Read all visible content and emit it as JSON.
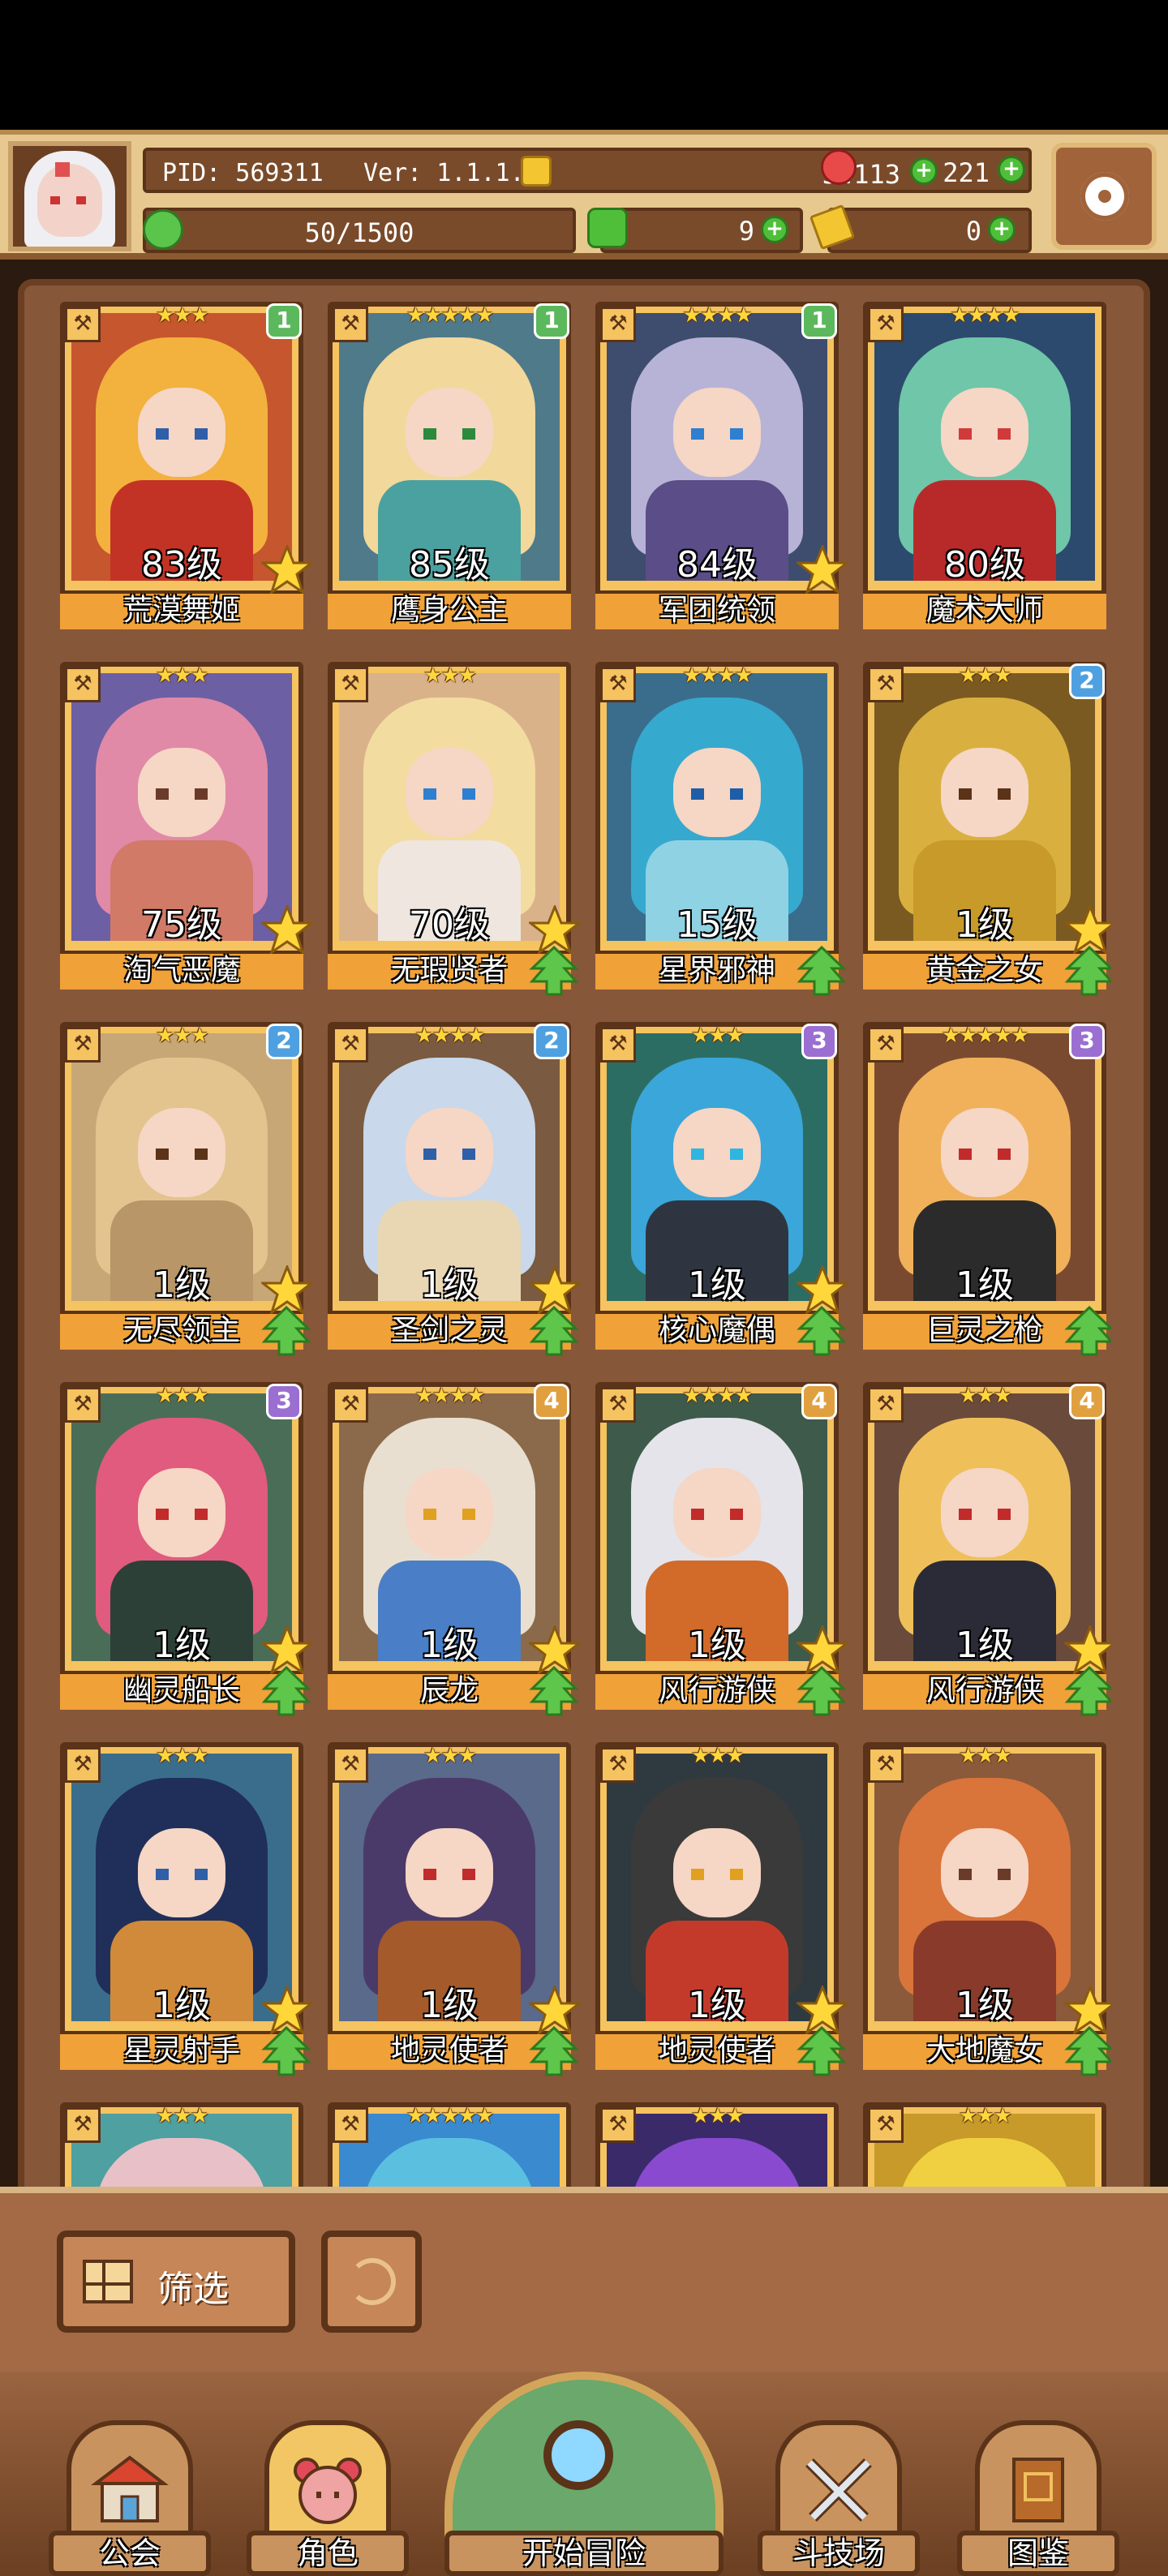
{
  "header": {
    "pid": "PID: 569311",
    "version": "Ver: 1.1.1.6",
    "gold": "54113",
    "gems": "221",
    "energy": "50/1500",
    "clover_count": "9",
    "keys": "0"
  },
  "cards": [
    {
      "stars": "★★★",
      "rank": "1",
      "rank_color": "#5cb85c",
      "level": "83级",
      "name": "荒漠舞姬",
      "bg": "#c6562d",
      "hair": "#f3b13d",
      "body": "#c33325",
      "eye": "#2f5fa8",
      "fav": true,
      "up": false
    },
    {
      "stars": "★★★★★",
      "rank": "1",
      "rank_color": "#5cb85c",
      "level": "85级",
      "name": "鹰身公主",
      "bg": "#4f7a8a",
      "hair": "#f2d89a",
      "body": "#4aa1a0",
      "eye": "#2b8a3b",
      "fav": false,
      "up": false
    },
    {
      "stars": "★★★★",
      "rank": "1",
      "rank_color": "#5cb85c",
      "level": "84级",
      "name": "军团统领",
      "bg": "#3e4d6e",
      "hair": "#b7b3d6",
      "body": "#5b4d87",
      "eye": "#2f7fd0",
      "fav": true,
      "up": false
    },
    {
      "stars": "★★★★",
      "rank": "",
      "rank_color": "",
      "level": "80级",
      "name": "魔术大师",
      "bg": "#2c4a6d",
      "hair": "#6fc6a9",
      "body": "#b82a2a",
      "eye": "#d13a3a",
      "fav": false,
      "up": false
    },
    {
      "stars": "★★★",
      "rank": "",
      "rank_color": "",
      "level": "75级",
      "name": "淘气恶魔",
      "bg": "#6d5fa3",
      "hair": "#e08aa7",
      "body": "#d27a68",
      "eye": "#6b3b2a",
      "fav": true,
      "up": false
    },
    {
      "stars": "★★★",
      "rank": "",
      "rank_color": "",
      "level": "70级",
      "name": "无瑕贤者",
      "bg": "#d9b28a",
      "hair": "#f3dca0",
      "body": "#f0e6e0",
      "eye": "#2f7fd0",
      "fav": true,
      "up": true
    },
    {
      "stars": "★★★★",
      "rank": "",
      "rank_color": "#4fb7d8",
      "level": "15级",
      "name": "星界邪神",
      "bg": "#3a6d8c",
      "hair": "#36a9cf",
      "body": "#8fd2e3",
      "eye": "#1e5ea8",
      "fav": false,
      "up": true
    },
    {
      "stars": "★★★",
      "rank": "2",
      "rank_color": "#4fa0e0",
      "level": "1级",
      "name": "黄金之女",
      "bg": "#7a5a20",
      "hair": "#d9b040",
      "body": "#c79a2a",
      "eye": "#5b3318",
      "fav": true,
      "up": true
    },
    {
      "stars": "★★★",
      "rank": "2",
      "rank_color": "#4fa0e0",
      "level": "1级",
      "name": "无尽领主",
      "bg": "#c7a775",
      "hair": "#e3c48e",
      "body": "#b99668",
      "eye": "#5b3318",
      "fav": true,
      "up": true
    },
    {
      "stars": "★★★★",
      "rank": "2",
      "rank_color": "#4fa0e0",
      "level": "1级",
      "name": "圣剑之灵",
      "bg": "#7a5a40",
      "hair": "#c9d8ea",
      "body": "#e9d7b4",
      "eye": "#2f5fa8",
      "fav": true,
      "up": true
    },
    {
      "stars": "★★★",
      "rank": "3",
      "rank_color": "#9b6fd1",
      "level": "1级",
      "name": "核心魔偶",
      "bg": "#2c6d63",
      "hair": "#3aa6d9",
      "body": "#2f3540",
      "eye": "#2fb6e0",
      "fav": true,
      "up": true
    },
    {
      "stars": "★★★★★",
      "rank": "3",
      "rank_color": "#9b6fd1",
      "level": "1级",
      "name": "巨灵之枪",
      "bg": "#7a4a30",
      "hair": "#f0b15a",
      "body": "#2b2b2b",
      "eye": "#c22b2b",
      "fav": false,
      "up": true
    },
    {
      "stars": "★★★",
      "rank": "3",
      "rank_color": "#9b6fd1",
      "level": "1级",
      "name": "幽灵船长",
      "bg": "#4a6d58",
      "hair": "#e05b7d",
      "body": "#2d4038",
      "eye": "#c22b2b",
      "fav": true,
      "up": true
    },
    {
      "stars": "★★★★",
      "rank": "4",
      "rank_color": "#e0a040",
      "level": "1级",
      "name": "辰龙",
      "bg": "#8a6a4a",
      "hair": "#e9dfd0",
      "body": "#4a7fc7",
      "eye": "#e0a020",
      "fav": true,
      "up": true
    },
    {
      "stars": "★★★★",
      "rank": "4",
      "rank_color": "#e0a040",
      "level": "1级",
      "name": "风行游侠",
      "bg": "#3e5a4a",
      "hair": "#e4e4ea",
      "body": "#d26a2a",
      "eye": "#c22b2b",
      "fav": true,
      "up": true
    },
    {
      "stars": "★★★",
      "rank": "4",
      "rank_color": "#e0a040",
      "level": "1级",
      "name": "风行游侠",
      "bg": "#6a4a3a",
      "hair": "#efc05a",
      "body": "#2b2b38",
      "eye": "#c22b2b",
      "fav": true,
      "up": true
    },
    {
      "stars": "★★★",
      "rank": "",
      "rank_color": "",
      "level": "1级",
      "name": "星灵射手",
      "bg": "#3a6d8c",
      "hair": "#1f2f5a",
      "body": "#d08a3a",
      "eye": "#2f5fa8",
      "fav": true,
      "up": true
    },
    {
      "stars": "★★★",
      "rank": "",
      "rank_color": "",
      "level": "1级",
      "name": "地灵使者",
      "bg": "#5a6a8a",
      "hair": "#4a3a6a",
      "body": "#a45a2a",
      "eye": "#c22b2b",
      "fav": true,
      "up": true
    },
    {
      "stars": "★★★",
      "rank": "",
      "rank_color": "",
      "level": "1级",
      "name": "地灵使者",
      "bg": "#2f3a40",
      "hair": "#3a3a3a",
      "body": "#c43a2a",
      "eye": "#e0a020",
      "fav": true,
      "up": true
    },
    {
      "stars": "★★★",
      "rank": "",
      "rank_color": "",
      "level": "1级",
      "name": "大地魔女",
      "bg": "#8a5a3a",
      "hair": "#d9743a",
      "body": "#8a3a2a",
      "eye": "#6b3b2a",
      "fav": true,
      "up": true
    },
    {
      "stars": "★★★",
      "rank": "",
      "rank_color": "",
      "level": "",
      "name": "",
      "bg": "#4fa0a0",
      "hair": "#e8c0c8",
      "body": "#4fa0a0",
      "eye": "#5b3318",
      "fav": false,
      "up": false
    },
    {
      "stars": "★★★★★",
      "rank": "",
      "rank_color": "",
      "level": "",
      "name": "",
      "bg": "#3a8ad0",
      "hair": "#5bc0e0",
      "body": "#3a8ad0",
      "eye": "#5b3318",
      "fav": false,
      "up": false
    },
    {
      "stars": "★★★",
      "rank": "",
      "rank_color": "",
      "level": "",
      "name": "",
      "bg": "#3a2a6a",
      "hair": "#8a4ad0",
      "body": "#3a2a6a",
      "eye": "#5b3318",
      "fav": false,
      "up": false
    },
    {
      "stars": "★★★",
      "rank": "",
      "rank_color": "",
      "level": "",
      "name": "",
      "bg": "#c79a2a",
      "hair": "#f0d040",
      "body": "#c79a2a",
      "eye": "#5b3318",
      "fav": false,
      "up": false
    }
  ],
  "controls": {
    "filter_label": "筛选"
  },
  "nav": {
    "guild": "公会",
    "characters": "角色",
    "adventure": "开始冒险",
    "arena": "斗技场",
    "codex": "图鉴"
  }
}
